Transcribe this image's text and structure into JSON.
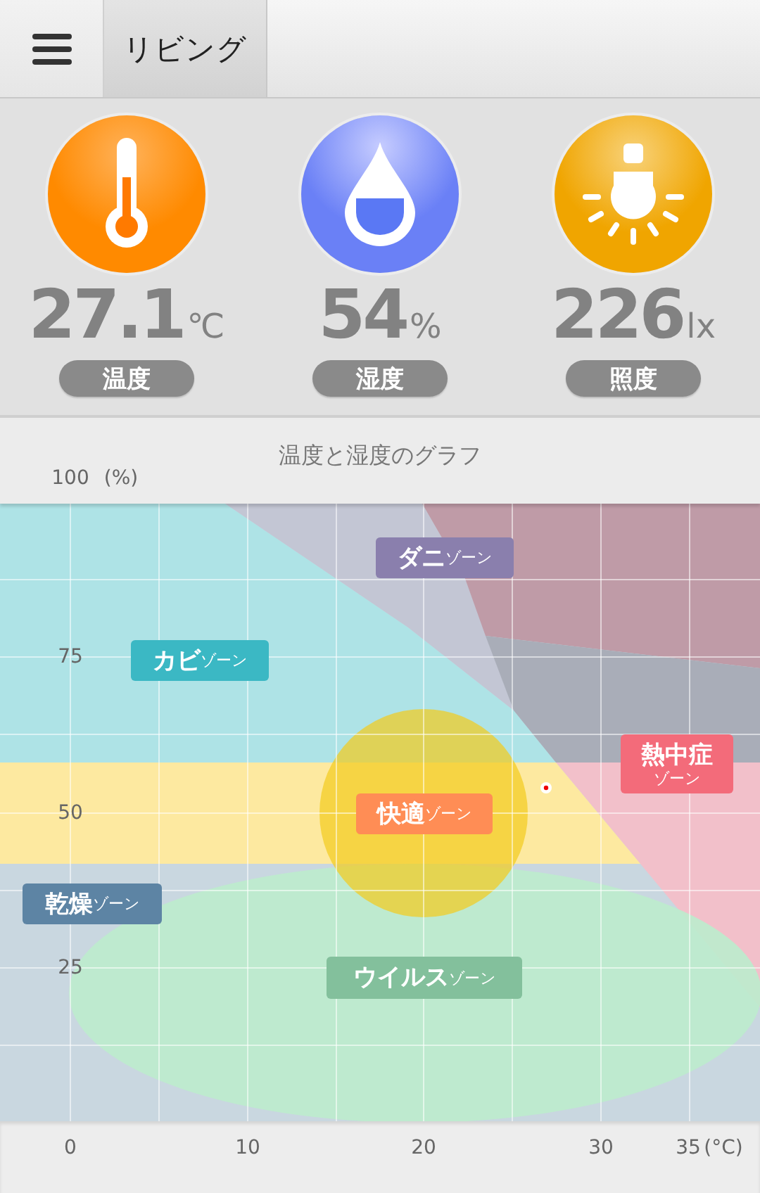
{
  "header": {
    "tabs": [
      {
        "label": "リビング",
        "selected": true
      }
    ]
  },
  "sensors": [
    {
      "kind": "temperature",
      "value": "27.1",
      "unit": "℃",
      "label": "温度"
    },
    {
      "kind": "humidity",
      "value": "54",
      "unit": "%",
      "label": "湿度"
    },
    {
      "kind": "light",
      "value": "226",
      "unit": "lx",
      "label": "照度"
    }
  ],
  "chart": {
    "title": "温度と湿度のグラフ",
    "y_ticks": [
      "100",
      "75",
      "50",
      "25"
    ],
    "y_unit": "(%)",
    "x_ticks": [
      "0",
      "10",
      "20",
      "30",
      "35"
    ],
    "x_unit": "(°C)",
    "zones": [
      {
        "name": "ダニ",
        "suffix": "ゾーン",
        "color": "#8a7fad",
        "kind": "inline"
      },
      {
        "name": "カビ",
        "suffix": "ゾーン",
        "color": "#3bb8c4",
        "kind": "inline"
      },
      {
        "name": "熱中症",
        "suffix": "ゾーン",
        "color": "#f36b7a",
        "kind": "stacked"
      },
      {
        "name": "快適",
        "suffix": "ゾーン",
        "color": "#ff8d55",
        "kind": "inline"
      },
      {
        "name": "乾燥",
        "suffix": "ゾーン",
        "color": "#5d84a4",
        "kind": "inline"
      },
      {
        "name": "ウイルス",
        "suffix": "ゾーン",
        "color": "#83c09c",
        "kind": "inline"
      }
    ]
  }
}
